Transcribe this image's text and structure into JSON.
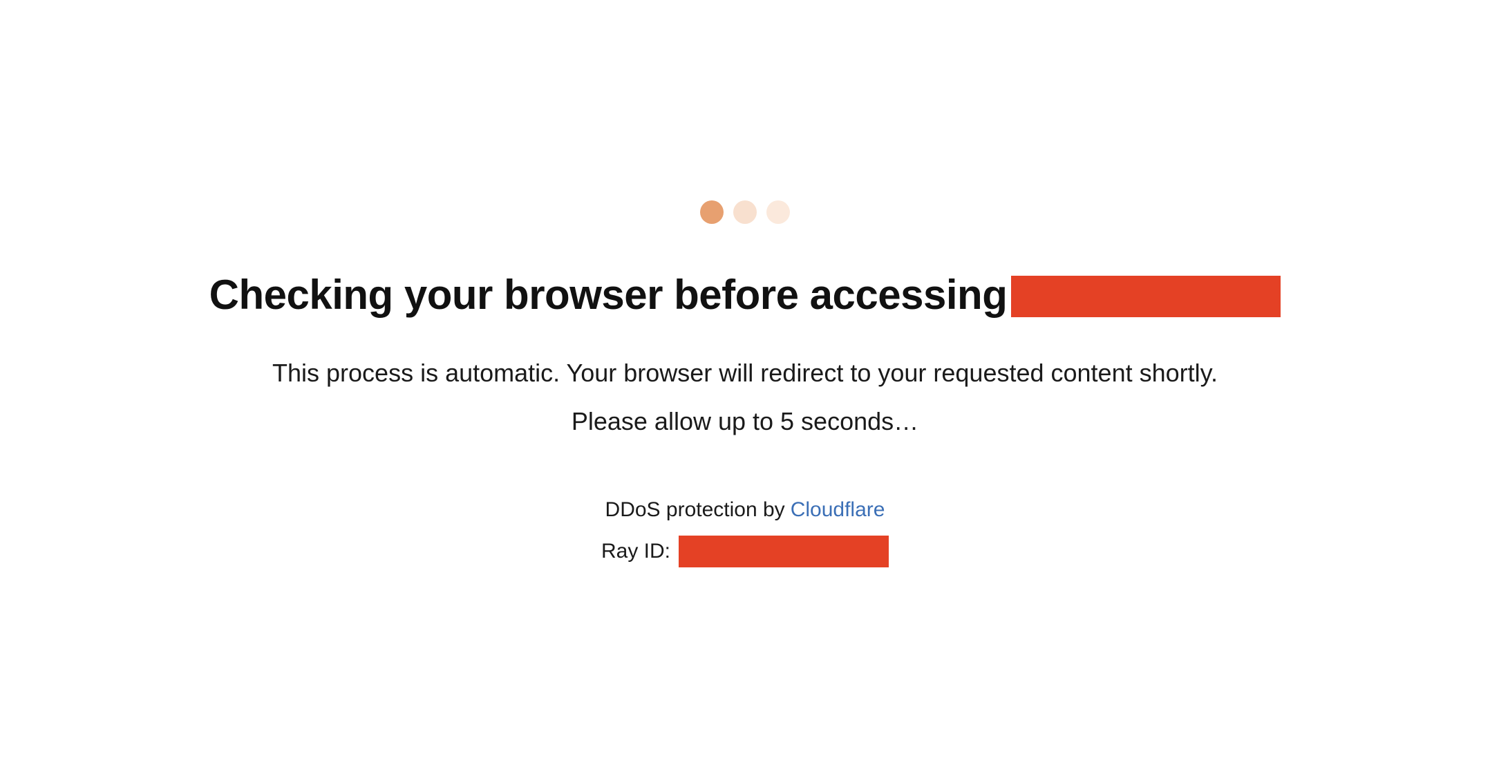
{
  "loader": {
    "dot_colors": [
      "#e7a070",
      "#f8e0cf",
      "#fbe9dc"
    ]
  },
  "heading": {
    "text": "Checking your browser before accessing"
  },
  "description": "This process is automatic. Your browser will redirect to your requested content shortly.",
  "wait_text": "Please allow up to 5 seconds…",
  "footer": {
    "protection_prefix": "DDoS protection by ",
    "provider": "Cloudflare",
    "ray_id_label": "Ray ID: "
  },
  "colors": {
    "redaction": "#e44125",
    "link": "#3b6fb6",
    "text": "#1a1a1a"
  }
}
